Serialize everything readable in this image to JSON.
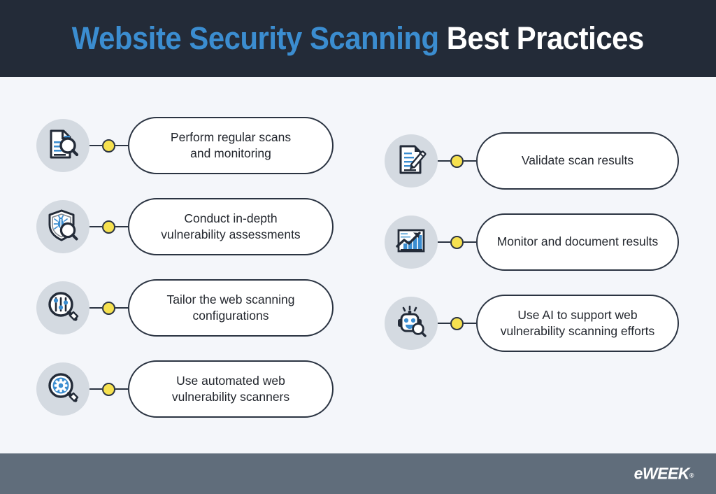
{
  "header": {
    "title_highlight": "Website Security Scanning",
    "title_rest": "Best Practices",
    "background_color": "#232b38",
    "highlight_color": "#3b8dd0",
    "rest_color": "#ffffff"
  },
  "theme": {
    "page_background": "#f4f6fa",
    "icon_circle_color": "#d4dae1",
    "connector_dot_color": "#f6e14f",
    "outline_color": "#2b3442",
    "accent_blue": "#3b8dd0",
    "footer_background": "#606d7b"
  },
  "practices": {
    "left_column": [
      {
        "icon": "document-magnifier-icon",
        "label": "Perform regular scans\nand monitoring",
        "line1": "Perform regular scans",
        "line2": "and monitoring"
      },
      {
        "icon": "shield-bug-magnifier-icon",
        "label": "Conduct in-depth\nvulnerability assessments",
        "line1": "Conduct in-depth",
        "line2": "vulnerability assessments"
      },
      {
        "icon": "magnifier-sliders-icon",
        "label": "Tailor the web scanning\nconfigurations",
        "line1": "Tailor the web scanning",
        "line2": "configurations"
      },
      {
        "icon": "magnifier-gear-icon",
        "label": "Use automated web\nvulnerability scanners",
        "line1": "Use automated web",
        "line2": "vulnerability scanners"
      }
    ],
    "right_column": [
      {
        "icon": "document-pencil-icon",
        "label": "Validate scan results",
        "line1": "Validate scan results",
        "line2": ""
      },
      {
        "icon": "bar-chart-arrow-icon",
        "label": "Monitor and document results",
        "line1": "Monitor and document results",
        "line2": ""
      },
      {
        "icon": "robot-magnifier-icon",
        "label": "Use AI to support web\nvulnerability scanning efforts",
        "line1": "Use AI to support web",
        "line2": "vulnerability scanning efforts"
      }
    ]
  },
  "footer": {
    "logo_e": "e",
    "logo_week": "WEEK",
    "logo_tm": "®"
  }
}
